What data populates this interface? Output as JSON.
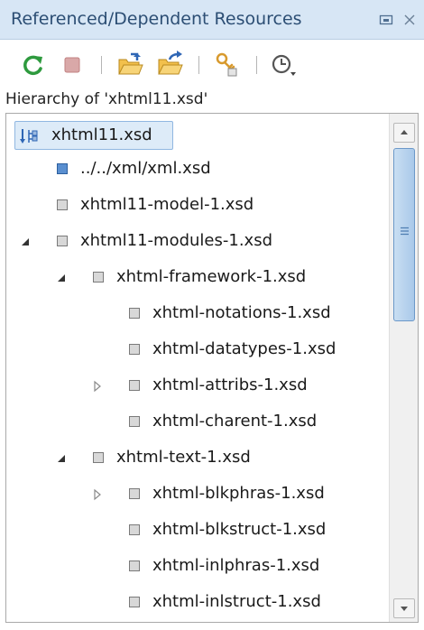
{
  "panel": {
    "title": "Referenced/Dependent Resources",
    "hierarchy_label": "Hierarchy of 'xhtml11.xsd'"
  },
  "toolbar": {
    "buttons": [
      {
        "name": "refresh-button",
        "icon": "refresh-icon"
      },
      {
        "name": "stop-button",
        "icon": "stop-icon"
      },
      {
        "name": "open-folder-button",
        "icon": "folder-open-icon"
      },
      {
        "name": "open-dependents-button",
        "icon": "folder-arrow-icon"
      },
      {
        "name": "search-references-button",
        "icon": "key-search-icon"
      },
      {
        "name": "history-button",
        "icon": "history-icon"
      }
    ]
  },
  "tree": {
    "root": "xhtml11.xsd",
    "items": [
      {
        "label": "../../xml/xml.xsd",
        "depth": 0,
        "toggle": "none",
        "icon": "blue"
      },
      {
        "label": "xhtml11-model-1.xsd",
        "depth": 0,
        "toggle": "none",
        "icon": "grey"
      },
      {
        "label": "xhtml11-modules-1.xsd",
        "depth": 0,
        "toggle": "expanded",
        "icon": "grey"
      },
      {
        "label": "xhtml-framework-1.xsd",
        "depth": 1,
        "toggle": "expanded",
        "icon": "grey"
      },
      {
        "label": "xhtml-notations-1.xsd",
        "depth": 2,
        "toggle": "none",
        "icon": "grey"
      },
      {
        "label": "xhtml-datatypes-1.xsd",
        "depth": 2,
        "toggle": "none",
        "icon": "grey"
      },
      {
        "label": "xhtml-attribs-1.xsd",
        "depth": 2,
        "toggle": "collapsed",
        "icon": "grey"
      },
      {
        "label": "xhtml-charent-1.xsd",
        "depth": 2,
        "toggle": "none",
        "icon": "grey"
      },
      {
        "label": "xhtml-text-1.xsd",
        "depth": 1,
        "toggle": "expanded",
        "icon": "grey"
      },
      {
        "label": "xhtml-blkphras-1.xsd",
        "depth": 2,
        "toggle": "collapsed",
        "icon": "grey"
      },
      {
        "label": "xhtml-blkstruct-1.xsd",
        "depth": 2,
        "toggle": "none",
        "icon": "grey"
      },
      {
        "label": "xhtml-inlphras-1.xsd",
        "depth": 2,
        "toggle": "none",
        "icon": "grey"
      },
      {
        "label": "xhtml-inlstruct-1.xsd",
        "depth": 2,
        "toggle": "none",
        "icon": "grey"
      }
    ]
  },
  "scrollbar": {
    "position": 0.0,
    "visible_fraction": 0.38
  }
}
